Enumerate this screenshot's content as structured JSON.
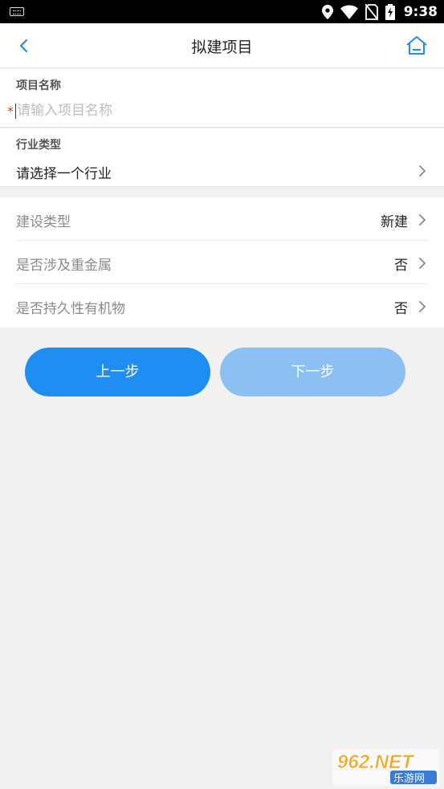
{
  "status_bar": {
    "time": "9:38",
    "icons": [
      "keyboard-icon",
      "location-icon",
      "wifi-icon",
      "no-sim-icon",
      "battery-charging-icon"
    ]
  },
  "navbar": {
    "title": "拟建项目",
    "back_icon": "chevron-left-icon",
    "home_icon": "home-icon"
  },
  "form": {
    "project_name": {
      "label": "项目名称",
      "required_mark": "*",
      "value": "",
      "placeholder": "请输入项目名称"
    },
    "industry": {
      "label": "行业类型",
      "value": "请选择一个行业"
    }
  },
  "options": [
    {
      "label": "建设类型",
      "value": "新建"
    },
    {
      "label": "是否涉及重金属",
      "value": "否"
    },
    {
      "label": "是否持久性有机物",
      "value": "否"
    }
  ],
  "buttons": {
    "prev": "上一步",
    "next": "下一步"
  },
  "watermark": {
    "top": "962.NET",
    "bottom": "乐游网"
  },
  "colors": {
    "accent": "#1e8ef3",
    "accent_disabled": "#8cc0f3",
    "required": "#dd3333",
    "background": "#f1f1f1"
  }
}
